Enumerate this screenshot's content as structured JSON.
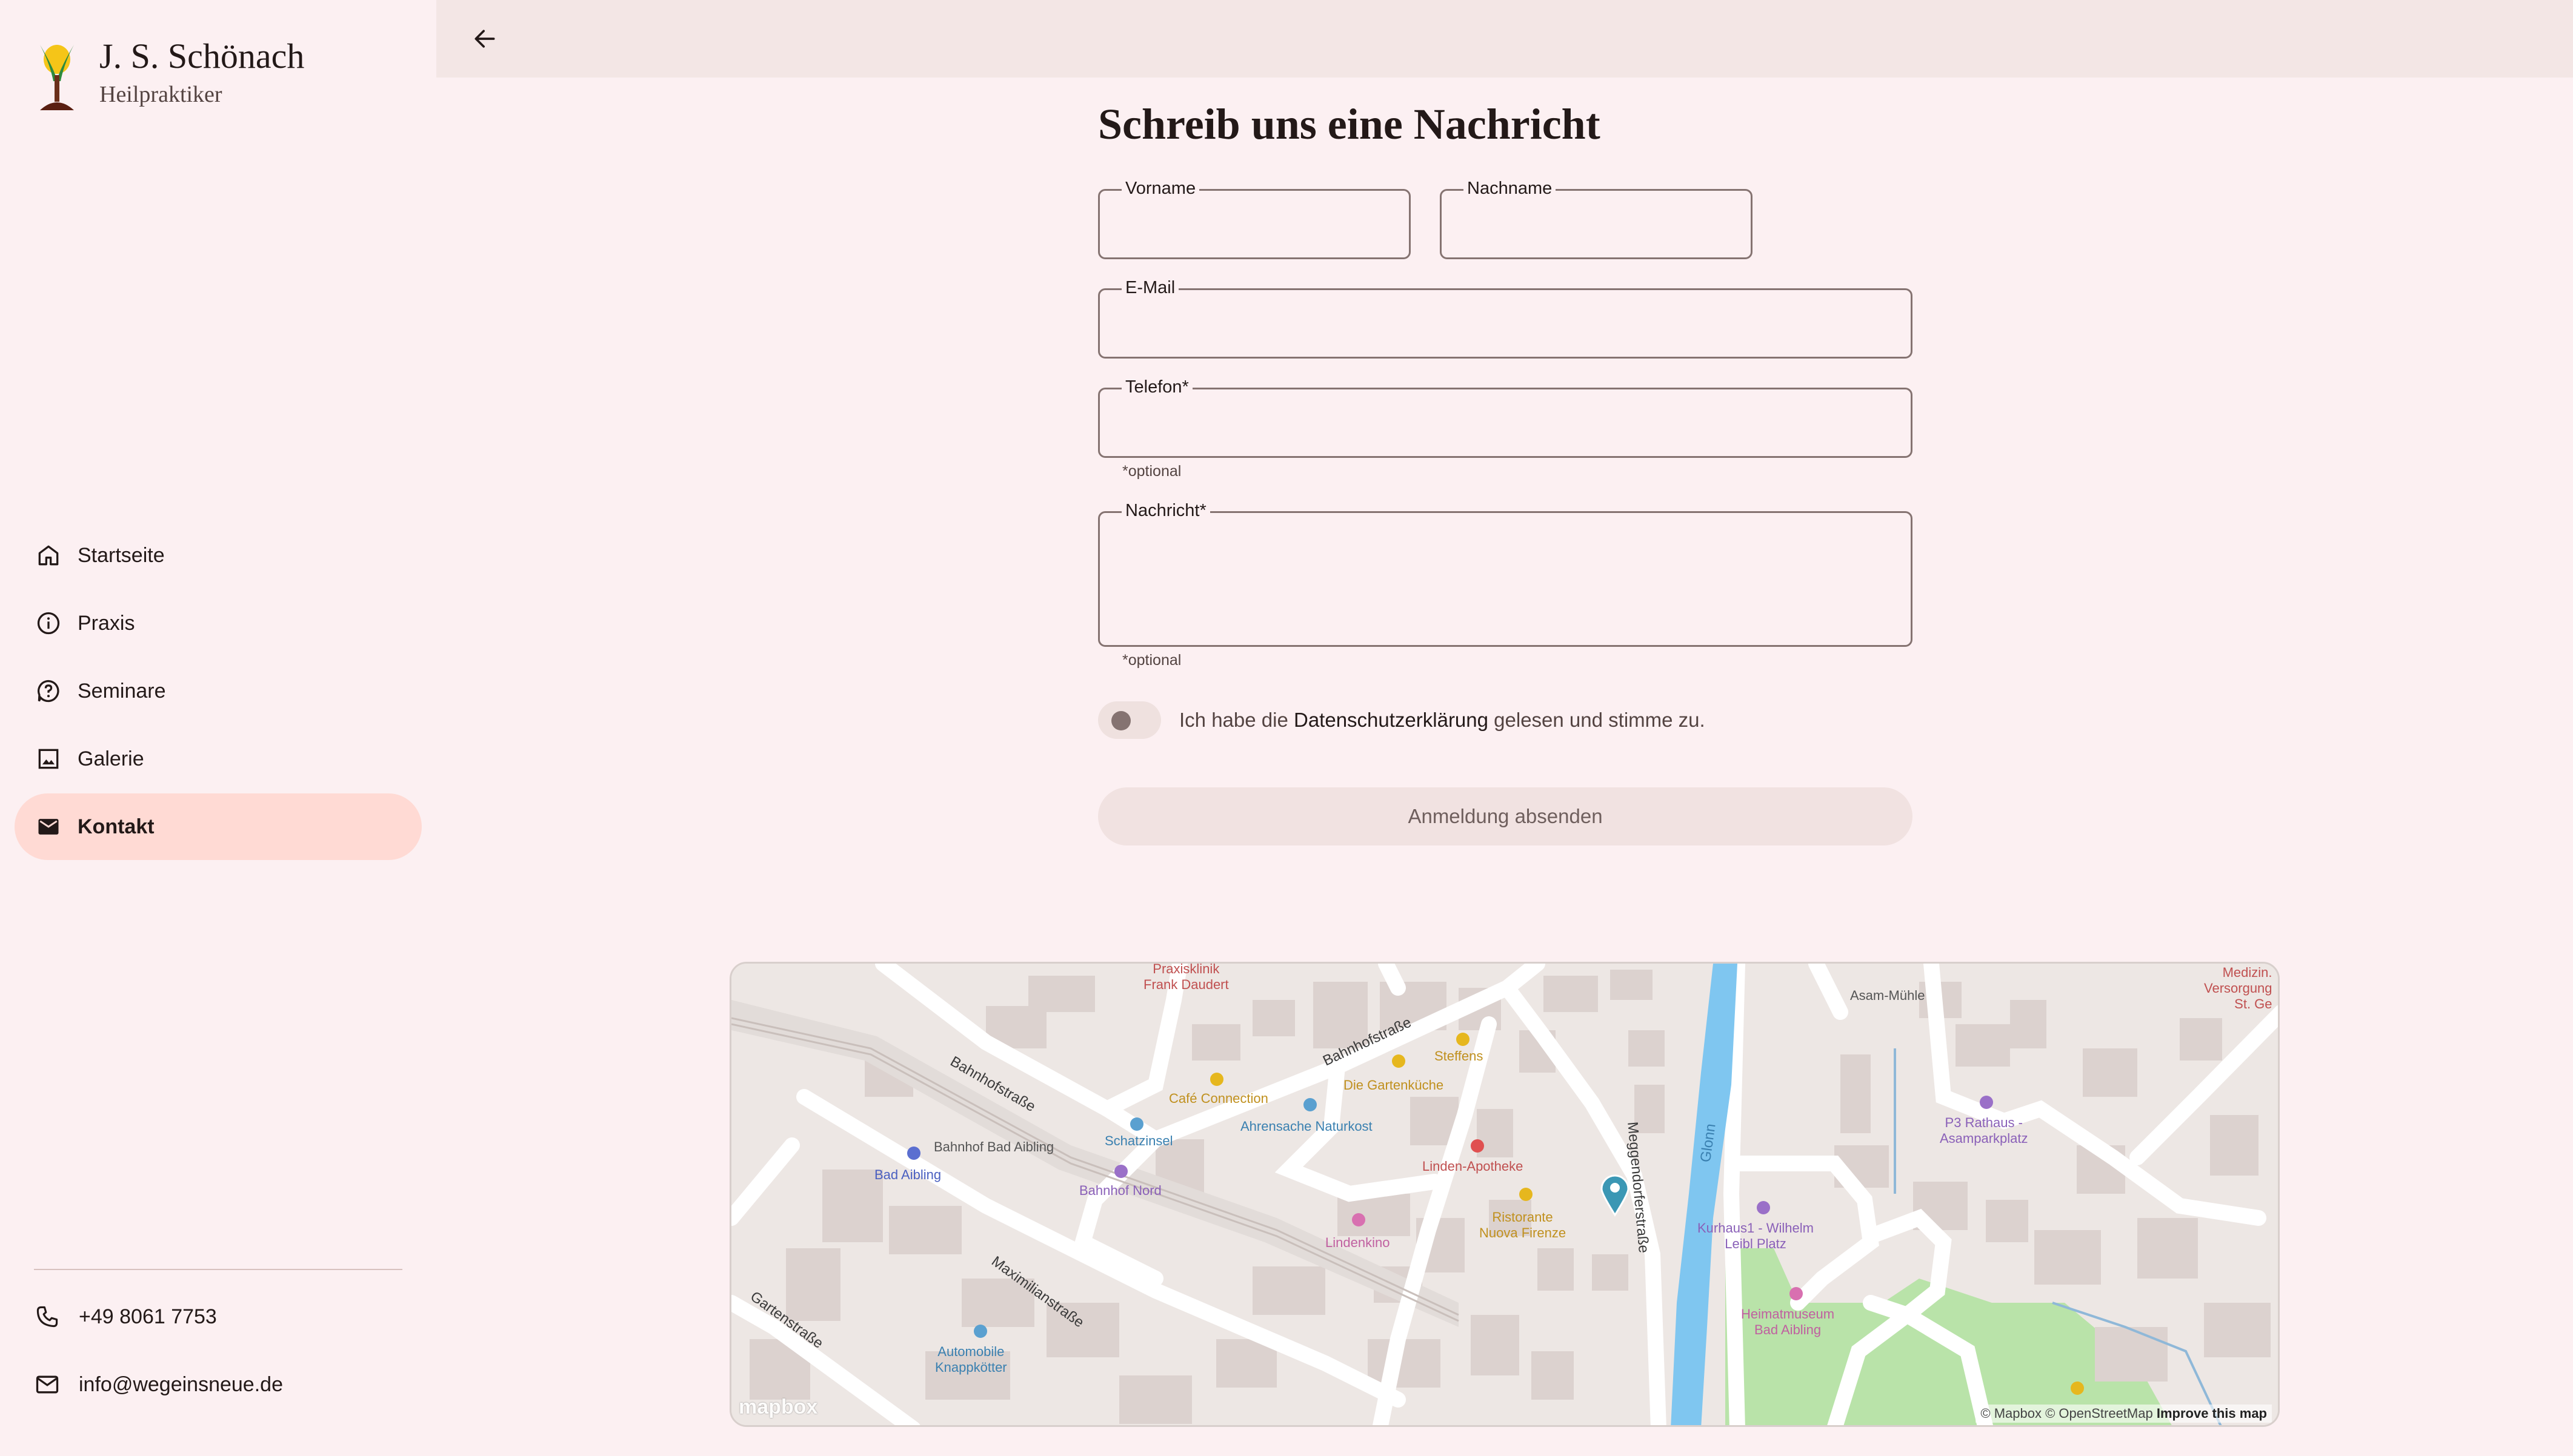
{
  "brand": {
    "name": "J. S. Schönach",
    "subtitle": "Heilpraktiker"
  },
  "nav": {
    "items": [
      {
        "label": "Startseite",
        "icon": "home-icon"
      },
      {
        "label": "Praxis",
        "icon": "info-icon"
      },
      {
        "label": "Seminare",
        "icon": "help-icon"
      },
      {
        "label": "Galerie",
        "icon": "image-icon"
      },
      {
        "label": "Kontakt",
        "icon": "mail-icon",
        "active": true
      }
    ]
  },
  "contact": {
    "phone": "+49 8061 7753",
    "email": "info@wegeinsneue.de"
  },
  "topbar": {
    "back_icon": "arrow-back-icon"
  },
  "form": {
    "title": "Schreib uns eine Nachricht",
    "firstname_label": "Vorname",
    "lastname_label": "Nachname",
    "email_label": "E-Mail",
    "phone_label": "Telefon*",
    "phone_helper": "*optional",
    "message_label": "Nachricht*",
    "message_helper": "*optional",
    "consent_prefix": "Ich habe die ",
    "consent_link": "Datenschutzerklärung",
    "consent_suffix": " gelesen und stimme zu.",
    "submit_label": "Anmeldung absenden"
  },
  "map": {
    "labels": {
      "praxisklinik": "Praxisklinik\nFrank Daudert",
      "asam": "Asam-Mühle",
      "medizin": "Medizin.\nVersorgung\nSt. Ge",
      "steffens": "Steffens",
      "gartenkuche": "Die Gartenküche",
      "cafe": "Café Connection",
      "ahrensache": "Ahrensache Naturkost",
      "schatzinsel": "Schatzinsel",
      "bahnhof_bad": "Bahnhof Bad Aibling",
      "bad_aibling": "Bad Aibling",
      "bahnhof_nord": "Bahnhof Nord",
      "linden_apotheke": "Linden-Apotheke",
      "ristorante": "Ristorante\nNuova Firenze",
      "lindenkino": "Lindenkino",
      "p3": "P3 Rathaus -\nAsamparkplatz",
      "kurhaus": "Kurhaus1 - Wilhelm\nLeibl Platz",
      "heimatmuseum": "Heimatmuseum\nBad Aibling",
      "automobile": "Automobile\nKnappkötter"
    },
    "streets": {
      "bahnhofstrasse_1": "Bahnhofstraße",
      "bahnhofstrasse_2": "Bahnhofstraße",
      "meggendorfer": "Meggendorferstraße",
      "glonn": "Glonn",
      "maximilian": "Maximilianstraße",
      "garten": "Gartenstraße"
    },
    "attribution": "© Mapbox © OpenStreetMap",
    "improve": "Improve this map",
    "logo": "mapbox",
    "pin_icon": "map-pin-icon"
  },
  "colors": {
    "background": "#fcf0f2",
    "active_nav": "#ffdad4",
    "topbar": "#f3e6e5",
    "river": "#7fc6f0",
    "park": "#b5e3a6",
    "pin": "#3b97b4"
  }
}
